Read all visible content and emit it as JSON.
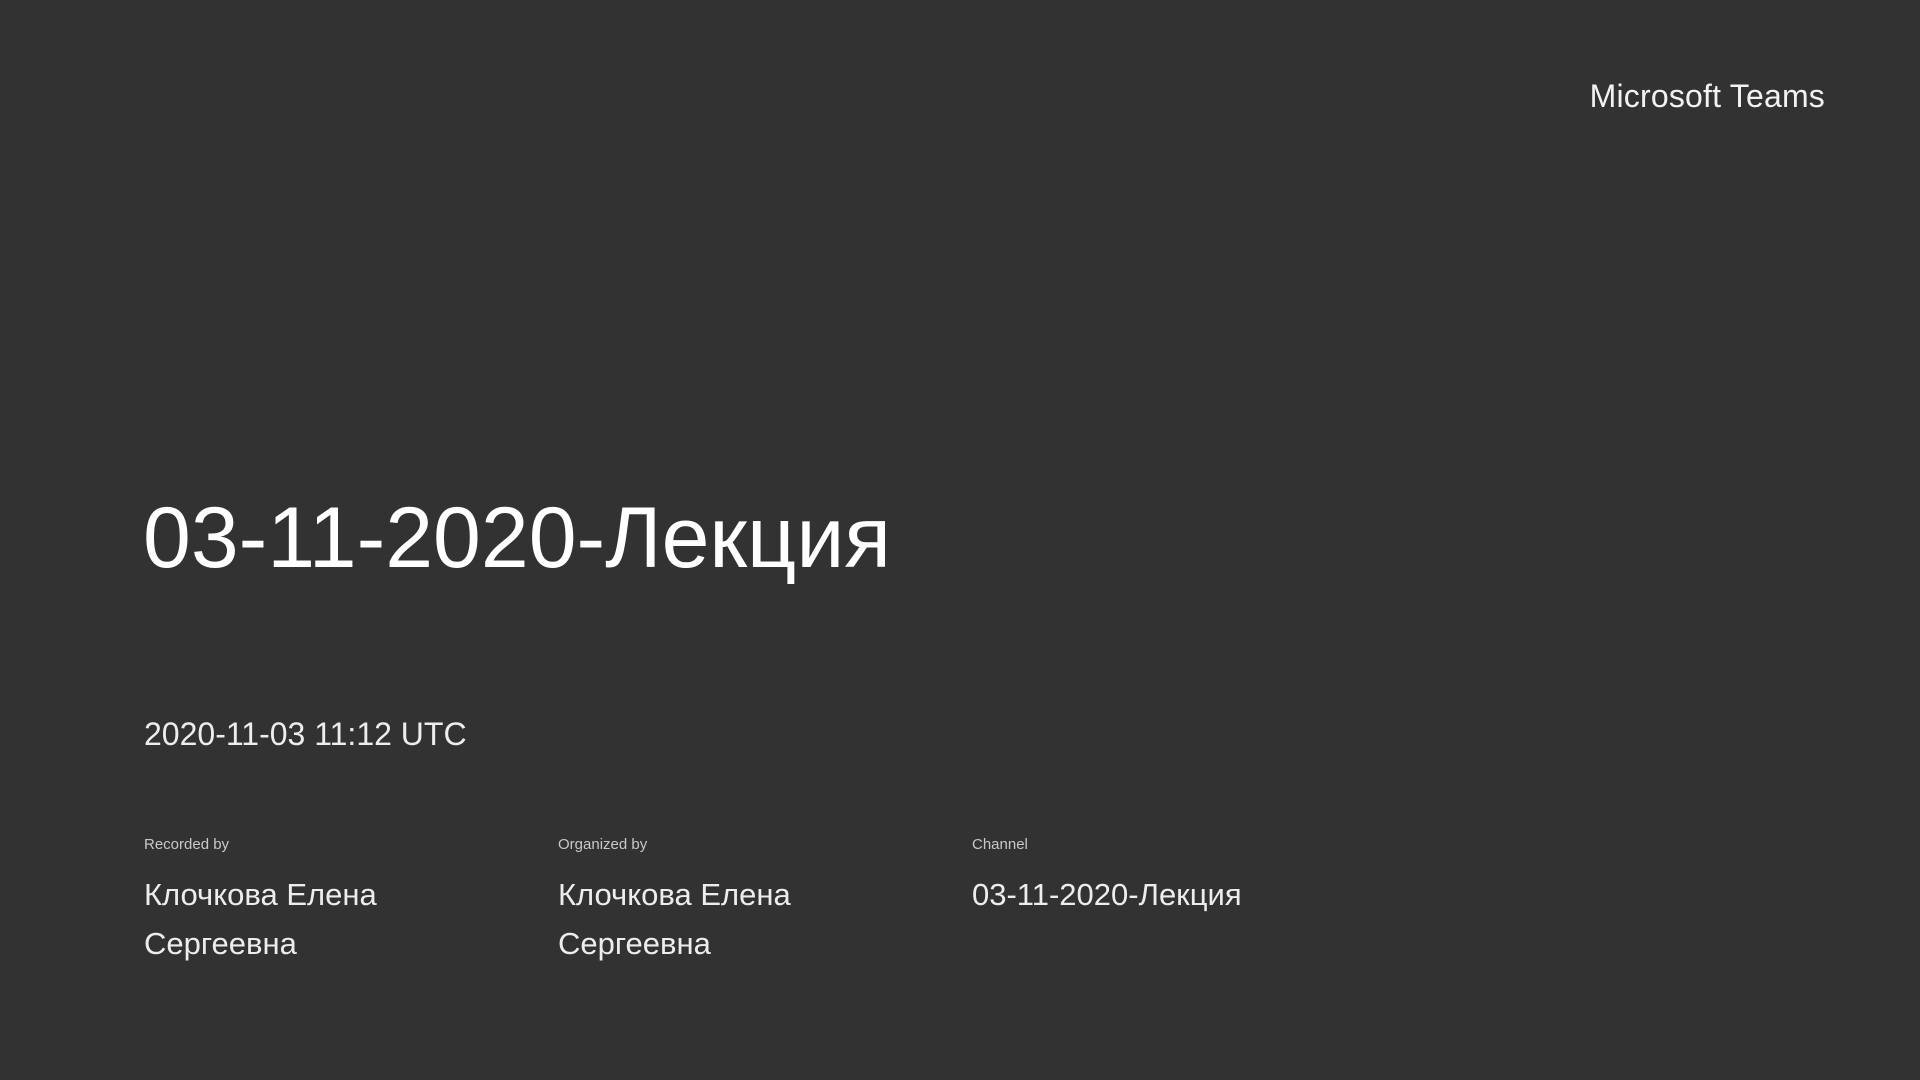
{
  "brand": "Microsoft Teams",
  "recording": {
    "title": "03-11-2020-Лекция",
    "datetime": "2020-11-03 11:12 UTC"
  },
  "meta": {
    "recorded_by": {
      "label": "Recorded by",
      "value": "Клочкова Елена Сергеевна"
    },
    "organized_by": {
      "label": "Organized by",
      "value": "Клочкова Елена Сергеевна"
    },
    "channel": {
      "label": "Channel",
      "value": "03-11-2020-Лекция"
    }
  }
}
